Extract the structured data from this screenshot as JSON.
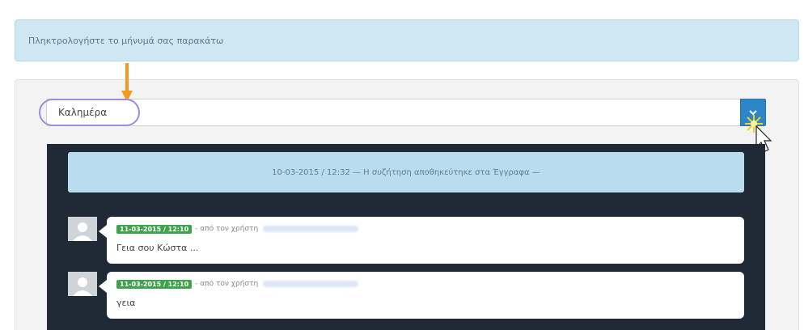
{
  "info_bar": {
    "text": "Πληκτρολογήστε το μήνυμά σας παρακάτω"
  },
  "input": {
    "value": "Καλημέρα"
  },
  "send_button": {
    "icon": "chevron-down-icon"
  },
  "chat": {
    "notice": "10-03-2015 / 12:32 — Η συζήτηση αποθηκεύτηκε στα Έγγραφα —",
    "messages": [
      {
        "time": "11-03-2015 / 12:10",
        "from_text": "- από τον χρήστη",
        "text": "Γεια σου Κώστα ..."
      },
      {
        "time": "11-03-2015 / 12:10",
        "from_text": "- από τον χρήστη",
        "text": "γεια"
      }
    ]
  },
  "colors": {
    "accent_blue": "#2b85c6",
    "time_badge_green": "#3fa34d",
    "arrow_orange": "#f39a1e",
    "highlight_purple": "#9d8be0",
    "chat_background": "#202a36"
  }
}
